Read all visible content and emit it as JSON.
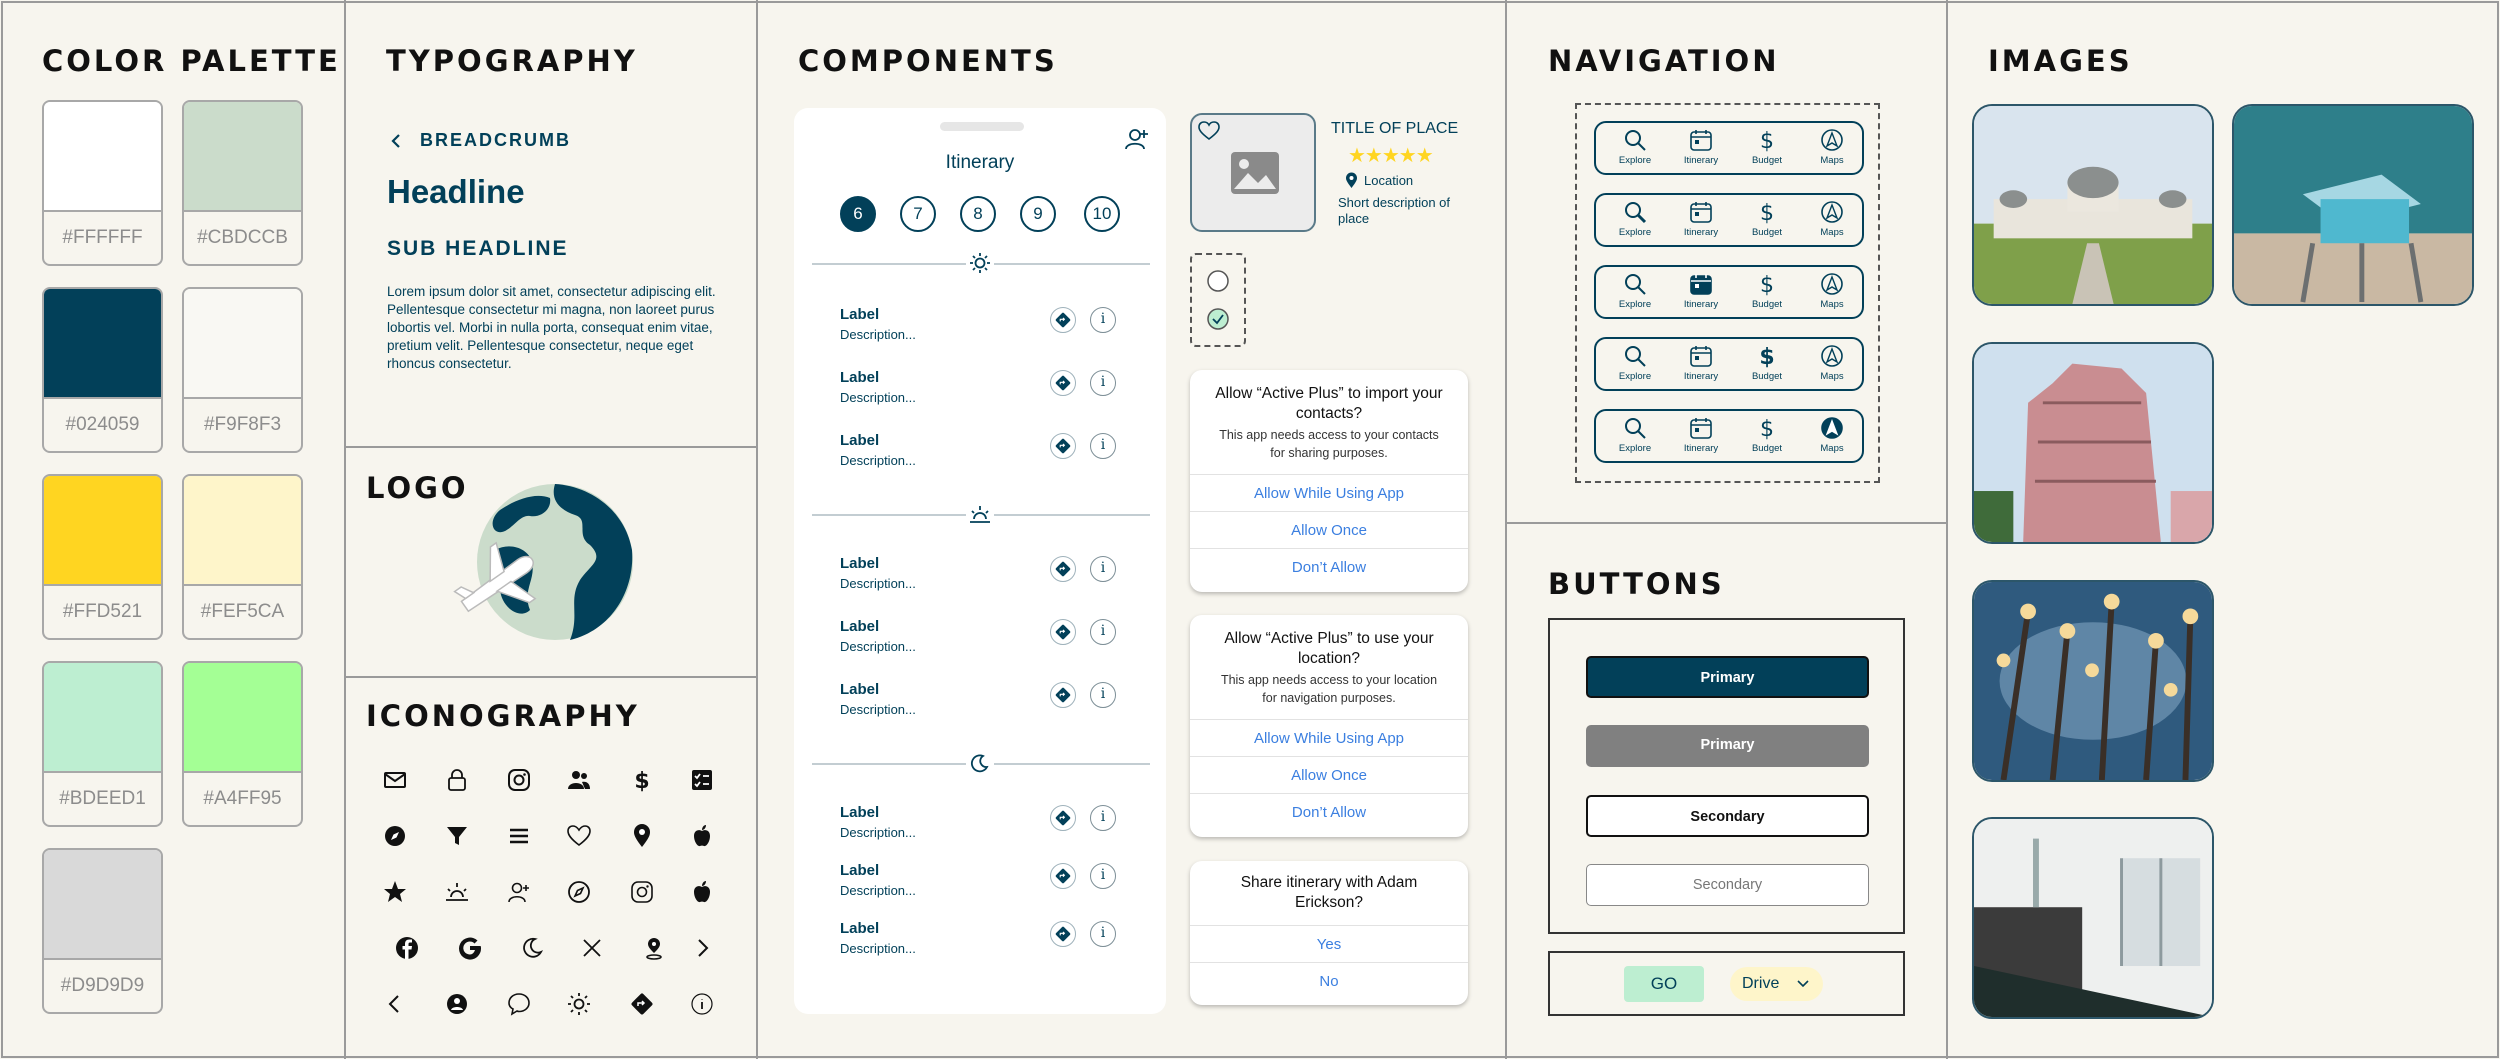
{
  "sections": {
    "color_palette": "COLOR PALETTE",
    "typography": "TYPOGRAPHY",
    "logo": "LOGO",
    "iconography": "ICONOGRAPHY",
    "components": "COMPONENTS",
    "navigation": "NAVIGATION",
    "buttons": "BUTTONS",
    "images": "IMAGES"
  },
  "palette": [
    {
      "hex": "#FFFFFF",
      "color": "#FFFFFF"
    },
    {
      "hex": "#CBDCCB",
      "color": "#CBDCCB"
    },
    {
      "hex": "#024059",
      "color": "#024059"
    },
    {
      "hex": "#F9F8F3",
      "color": "#F9F8F3"
    },
    {
      "hex": "#FFD521",
      "color": "#FFD521"
    },
    {
      "hex": "#FEF5CA",
      "color": "#FEF5CA"
    },
    {
      "hex": "#BDEED1",
      "color": "#BDEED1"
    },
    {
      "hex": "#A4FF95",
      "color": "#A4FF95"
    },
    {
      "hex": "#D9D9D9",
      "color": "#D9D9D9"
    }
  ],
  "typography": {
    "breadcrumb": "BREADCRUMB",
    "headline": "Headline",
    "sub_headline": "SUB HEADLINE",
    "body": "Lorem ipsum dolor sit amet, consectetur adipiscing elit. Pellentesque consectetur mi magna, non laoreet purus lobortis vel. Morbi in nulla porta, consequat enim vitae, pretium velit. Pellentesque consectetur, neque eget rhoncus consectetur."
  },
  "iconography": {
    "icons": [
      "mail-icon",
      "lock-icon",
      "instagram-icon",
      "users-icon",
      "dollar-icon",
      "checklist-icon",
      "compass-icon",
      "filter-icon",
      "menu-icon",
      "heart-icon",
      "location-pin-icon",
      "apple-icon",
      "star-icon",
      "sunrise-icon",
      "add-user-icon",
      "compass-outline-icon",
      "instagram-outline-icon",
      "apple-outline-icon",
      "facebook-icon",
      "google-icon",
      "moon-icon",
      "close-icon",
      "pin-person-icon",
      "chevron-right-icon",
      "chevron-left-icon",
      "avatar-icon",
      "chat-bubble-icon",
      "sun-icon",
      "directions-icon",
      "info-icon"
    ]
  },
  "itinerary": {
    "title": "Itinerary",
    "days": [
      "6",
      "7",
      "8",
      "9",
      "10"
    ],
    "active_day": "6",
    "rows": [
      {
        "label": "Label",
        "desc": "Description..."
      },
      {
        "label": "Label",
        "desc": "Description..."
      },
      {
        "label": "Label",
        "desc": "Description..."
      },
      {
        "label": "Label",
        "desc": "Description..."
      },
      {
        "label": "Label",
        "desc": "Description..."
      },
      {
        "label": "Label",
        "desc": "Description..."
      },
      {
        "label": "Label",
        "desc": "Description..."
      },
      {
        "label": "Label",
        "desc": "Description..."
      },
      {
        "label": "Label",
        "desc": "Description..."
      }
    ],
    "info_glyph": "i"
  },
  "place_card": {
    "title": "TITLE OF PLACE",
    "stars": "★★★★★",
    "location": "Location",
    "description": "Short description of place"
  },
  "dialogs": {
    "contacts": {
      "title": "Allow “Active Plus” to import your contacts?",
      "body": "This app needs access to your contacts for sharing purposes.",
      "buttons": [
        "Allow While Using App",
        "Allow Once",
        "Don’t Allow"
      ]
    },
    "location": {
      "title": "Allow “Active Plus” to use your location?",
      "body": "This app needs access to your location for navigation purposes.",
      "buttons": [
        "Allow While Using App",
        "Allow Once",
        "Don’t Allow"
      ]
    },
    "share": {
      "title": "Share itinerary with Adam Erickson?",
      "buttons": [
        "Yes",
        "No"
      ]
    }
  },
  "navigation": {
    "items": [
      "Explore",
      "Itinerary",
      "Budget",
      "Maps"
    ],
    "variants_active": [
      "none",
      "Explore",
      "Itinerary",
      "Budget",
      "Maps"
    ]
  },
  "buttons": {
    "primary": "Primary",
    "primary_disabled": "Primary",
    "secondary": "Secondary",
    "secondary_disabled": "Secondary",
    "go": "GO",
    "drive": "Drive"
  },
  "colors": {
    "brand": "#024059",
    "accent_yellow": "#FFD521",
    "mint": "#BDEED1",
    "cream": "#FEF5CA",
    "link_blue": "#3b7fe0",
    "disabled": "#808080"
  },
  "images": [
    "observatory-photo",
    "lifeguard-tower-photo",
    "hotel-tower-photo",
    "street-lamps-photo",
    "clothing-store-photo"
  ]
}
